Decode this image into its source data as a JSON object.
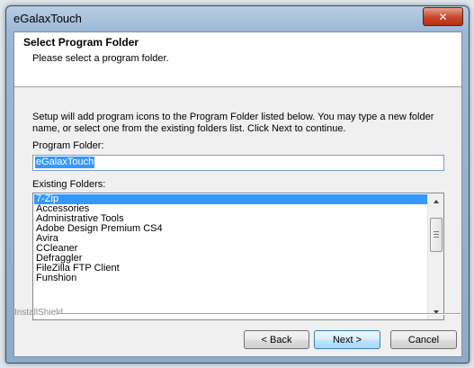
{
  "window": {
    "title": "eGalaxTouch",
    "close_glyph": "✕"
  },
  "header": {
    "title": "Select Program Folder",
    "subtitle": "Please select a program folder."
  },
  "description": "Setup will add program icons to the Program Folder listed below.  You may type a new folder name, or select one from the existing folders list.  Click Next to continue.",
  "program_folder": {
    "label": "Program Folder:",
    "value": "eGalaxTouch"
  },
  "existing_folders": {
    "label": "Existing Folders:",
    "items": [
      "7-Zip",
      "Accessories",
      "Administrative Tools",
      "Adobe Design Premium CS4",
      "Avira",
      "CCleaner",
      "Defraggler",
      "FileZilla FTP Client",
      "Funshion"
    ],
    "selected": "7-Zip"
  },
  "footer": {
    "brand": "InstallShield",
    "back_label": "< Back",
    "next_label": "Next >",
    "cancel_label": "Cancel"
  },
  "colors": {
    "selection": "#3399ff",
    "close_button": "#c8442a"
  }
}
